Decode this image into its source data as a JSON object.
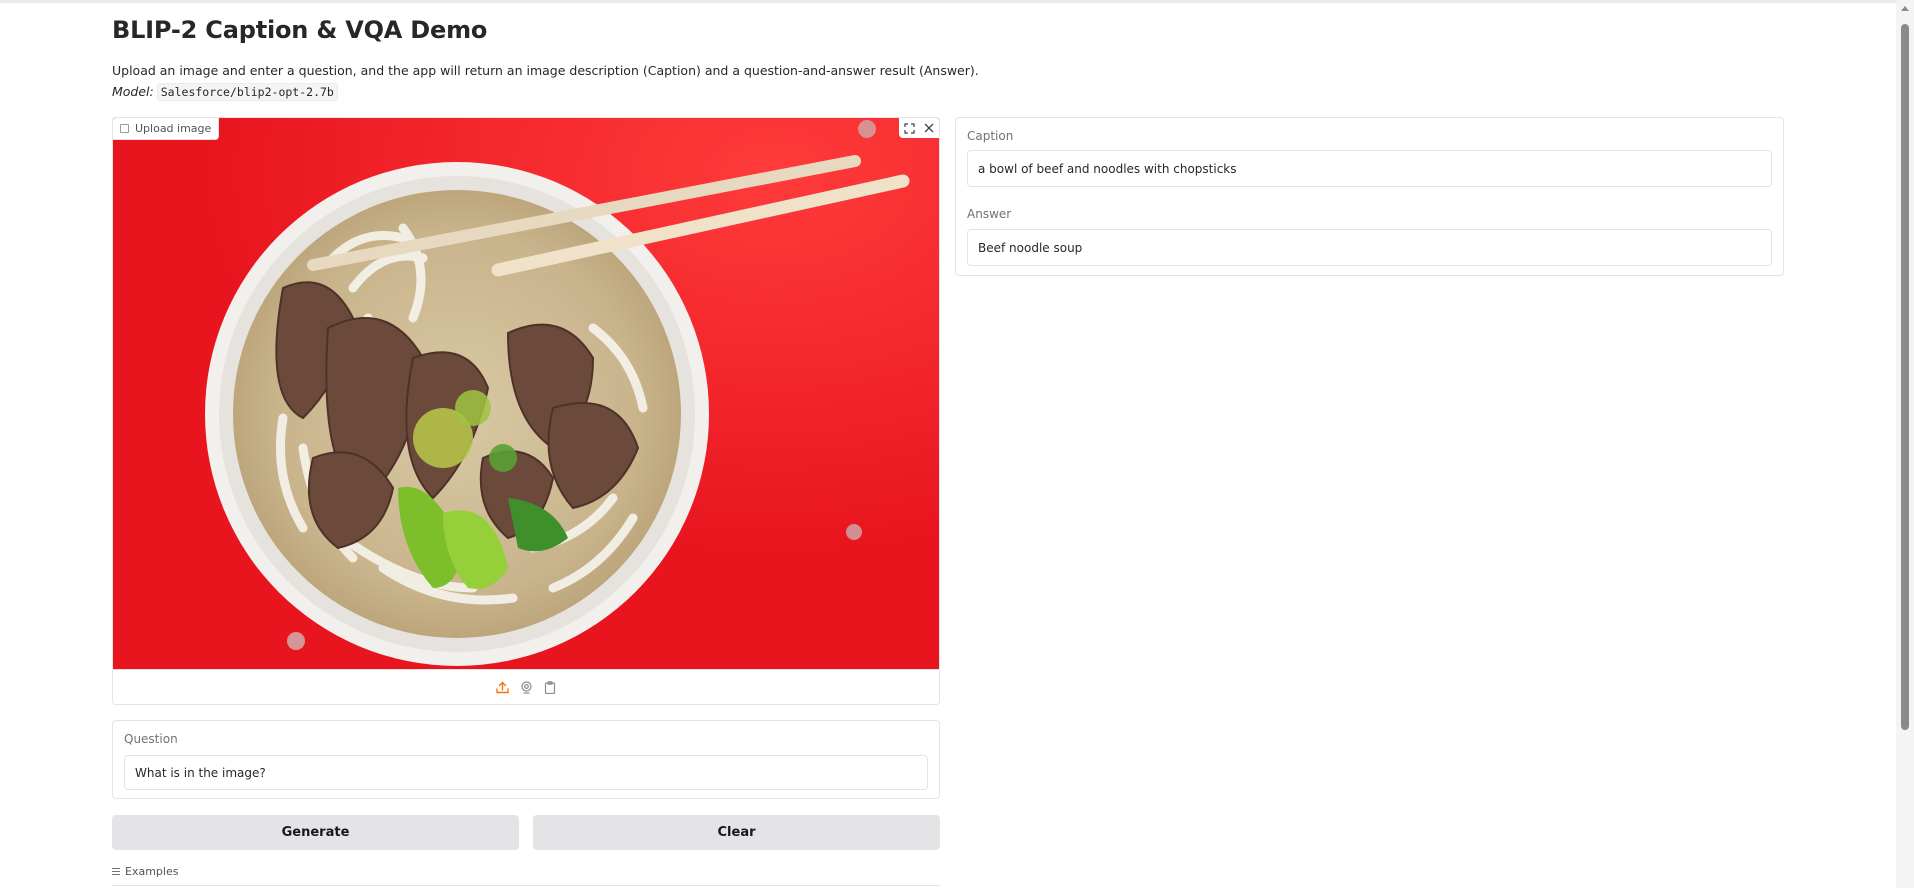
{
  "app": {
    "title": "BLIP-2 Caption & VQA Demo",
    "description": "Upload an image and enter a question, and the app will return an image description (Caption) and a question-and-answer result (Answer).",
    "model_label": "Model:",
    "model_id": "Salesforce/blip2-opt-2.7b"
  },
  "image_input": {
    "label": "Upload image",
    "icons": [
      "image-icon",
      "fullscreen-icon",
      "close-icon",
      "upload-icon",
      "webcam-icon",
      "clipboard-icon"
    ],
    "upload_icon_color": "#f97316"
  },
  "question": {
    "label": "Question",
    "value": "What is in the image?"
  },
  "buttons": {
    "generate": "Generate",
    "clear": "Clear"
  },
  "examples": {
    "label": "Examples"
  },
  "outputs": {
    "caption_label": "Caption",
    "caption_value": "a bowl of beef and noodles with chopsticks",
    "answer_label": "Answer",
    "answer_value": "Beef noodle soup"
  },
  "colors": {
    "photo_background": "#e8141e",
    "button_background": "#e4e4e7",
    "border": "#e4e4e7"
  }
}
